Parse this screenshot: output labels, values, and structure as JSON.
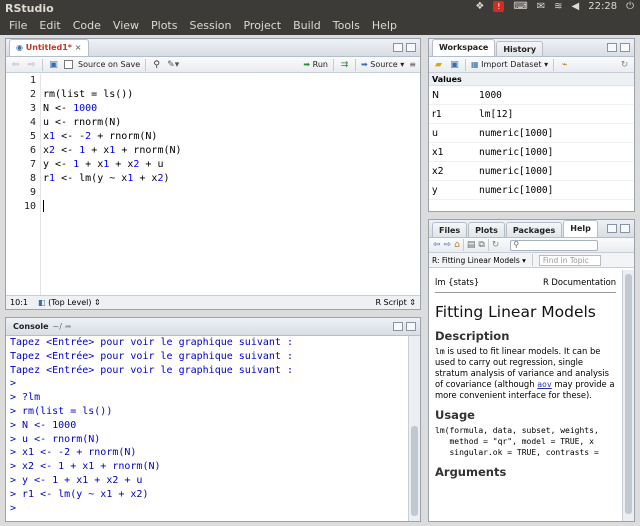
{
  "window": {
    "title": "RStudio"
  },
  "tray": {
    "badge": "!",
    "time": "22:28"
  },
  "menu": [
    "File",
    "Edit",
    "Code",
    "View",
    "Plots",
    "Session",
    "Project",
    "Build",
    "Tools",
    "Help"
  ],
  "source": {
    "tab_label": "Untitled1*",
    "source_on_save": "Source on Save",
    "run_label": "Run",
    "source_label": "Source",
    "lines": [
      "",
      "rm(list = ls())",
      "N <- 1000",
      "u <- rnorm(N)",
      "x1 <- -2 + rnorm(N)",
      "x2 <- 1 + x1 + rnorm(N)",
      "y <- 1 + x1 + x2 + u",
      "r1 <- lm(y ~ x1 + x2)",
      "",
      ""
    ],
    "line_numbers": [
      "1",
      "2",
      "3",
      "4",
      "5",
      "6",
      "7",
      "8",
      "9",
      "10"
    ],
    "status_position": "10:1",
    "status_scope": "(Top Level)",
    "status_type": "R Script"
  },
  "console": {
    "title": "Console",
    "path": "~/",
    "lines": [
      "Tapez <Entrée> pour voir le graphique suivant :",
      "Tapez <Entrée> pour voir le graphique suivant :",
      "Tapez <Entrée> pour voir le graphique suivant :",
      ">",
      "> ?lm",
      "> rm(list = ls())",
      "> N <- 1000",
      "> u <- rnorm(N)",
      "> x1 <- -2 + rnorm(N)",
      "> x2 <- 1 + x1 + rnorm(N)",
      "> y <- 1 + x1 + x2 + u",
      "> r1 <- lm(y ~ x1 + x2)",
      ">"
    ]
  },
  "workspace": {
    "tabs": [
      "Workspace",
      "History"
    ],
    "import_label": "Import Dataset",
    "section": "Values",
    "rows": [
      {
        "name": "N",
        "value": "1000"
      },
      {
        "name": "r1",
        "value": "lm[12]"
      },
      {
        "name": "u",
        "value": "numeric[1000]"
      },
      {
        "name": "x1",
        "value": "numeric[1000]"
      },
      {
        "name": "x2",
        "value": "numeric[1000]"
      },
      {
        "name": "y",
        "value": "numeric[1000]"
      }
    ]
  },
  "help": {
    "tabs": [
      "Files",
      "Plots",
      "Packages",
      "Help"
    ],
    "topic": "R: Fitting Linear Models",
    "find_placeholder": "Find in Topic",
    "header_left": "lm {stats}",
    "header_right": "R Documentation",
    "title": "Fitting Linear Models",
    "description_heading": "Description",
    "desc_code": "lm",
    "desc_1": " is used to fit linear models. It can be used to carry out regression, single stratum analysis of variance and analysis of covariance (although ",
    "desc_link": "aov",
    "desc_2": " may provide a more convenient interface for these).",
    "usage_heading": "Usage",
    "usage_lines": [
      "lm(formula, data, subset, weights,",
      "   method = \"qr\", model = TRUE, x",
      "   singular.ok = TRUE, contrasts ="
    ],
    "arguments_heading": "Arguments"
  }
}
